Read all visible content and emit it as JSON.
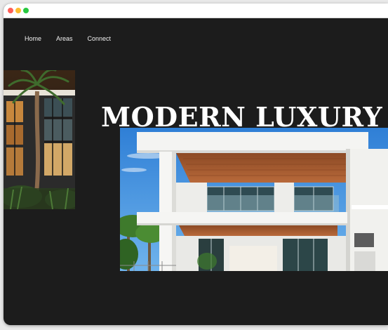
{
  "nav": {
    "items": [
      "Home",
      "Areas",
      "Connect"
    ]
  },
  "hero": {
    "title": "MODERN LUXURY HO"
  },
  "colors": {
    "page_bg": "#1c1c1c",
    "titlebar_bg": "#ffffff",
    "dot_red": "#ff5f57",
    "dot_yellow": "#febc2e",
    "dot_green": "#28c840"
  }
}
